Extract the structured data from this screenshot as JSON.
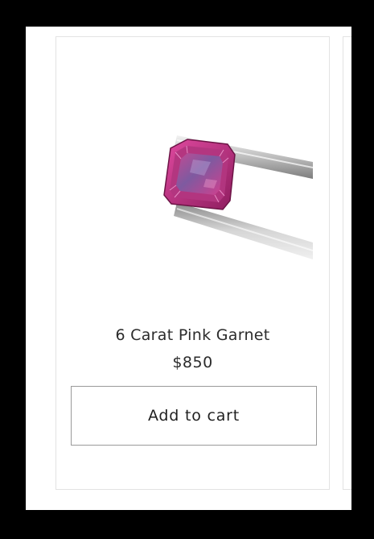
{
  "product": {
    "title": "6 Carat Pink Garnet",
    "price": "$850",
    "add_to_cart_label": "Add to cart",
    "image_icon": "garnet-gemstone-in-tweezers",
    "gem_color": "#b0327a"
  }
}
